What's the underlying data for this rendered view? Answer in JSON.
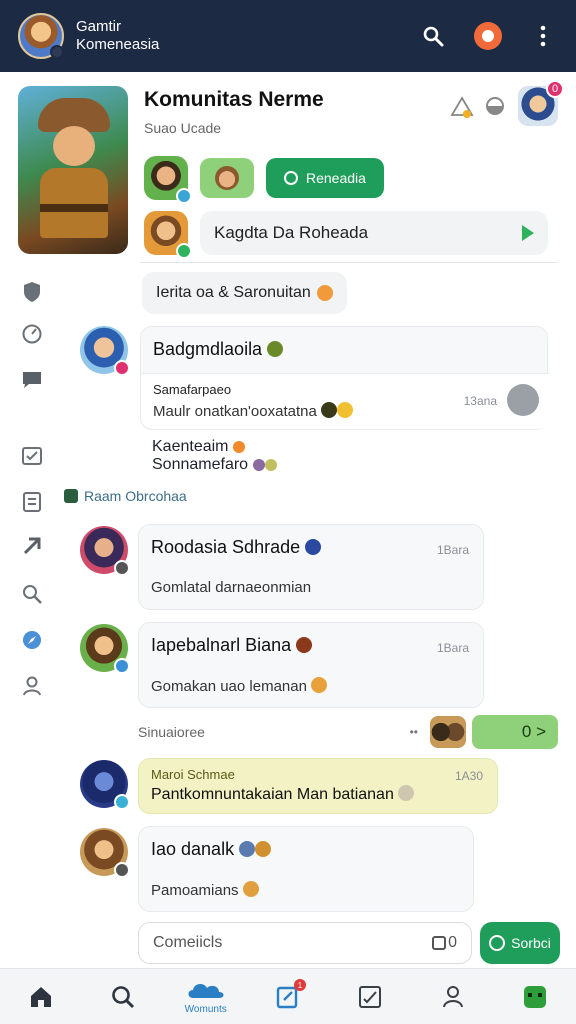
{
  "app_bar": {
    "title": "Gamtir",
    "subtitle": "Komeneasia",
    "icons": [
      "search-icon",
      "record-icon",
      "more-vertical-icon"
    ]
  },
  "community": {
    "title": "Komunitas Nerme",
    "subtitle": "Suao Ucade",
    "join_button": "Reneadia",
    "input_text": "Kagdta Da Roheada",
    "profile_badge": "0"
  },
  "chip": {
    "text": "Ierita oa & Saronuitan"
  },
  "messages": [
    {
      "name": "Badgmdlaoila",
      "sub1_title": "Samafarpaeo",
      "sub1_text": "Maulr onatkan'ooxatatna",
      "sub1_time": "13ana",
      "sub2_title": "Kaenteaim",
      "sub2_text": "Sonnamefaro"
    },
    {
      "name": "Roodasia Sdhrade",
      "time": "1Bara",
      "text": "Gomlatal darnaeonmian"
    },
    {
      "name": "Iapebalnarl Biana",
      "time": "1Bara",
      "text": "Gomakan uao lemanan"
    },
    {
      "title": "Maroi Schmae",
      "time": "1A30",
      "text": "Pantkomnuntakaian Man batianan"
    },
    {
      "name": "Iao danalk",
      "text": "Pamoamians"
    }
  ],
  "section_label": "Raam Obrcohaa",
  "structure_row": {
    "label": "Sinuaioree",
    "dots": "••",
    "button": "0 >"
  },
  "composer": {
    "placeholder": "Comeiicls",
    "icon_text": "0",
    "send_label": "Sorbci"
  },
  "bottom_nav": {
    "items": [
      {
        "icon": "home-icon"
      },
      {
        "icon": "search-icon"
      },
      {
        "icon": "cloud-community-icon",
        "label": "Womunts"
      },
      {
        "icon": "edit-note-icon",
        "badge": "1"
      },
      {
        "icon": "checklist-icon"
      },
      {
        "icon": "profile-icon"
      },
      {
        "icon": "game-app-icon"
      }
    ]
  },
  "colors": {
    "appbar": "#1d2a44",
    "accent_green": "#1e9e5a",
    "chip_green": "#8fd07a",
    "highlight_yellow": "#f2f2c4"
  }
}
